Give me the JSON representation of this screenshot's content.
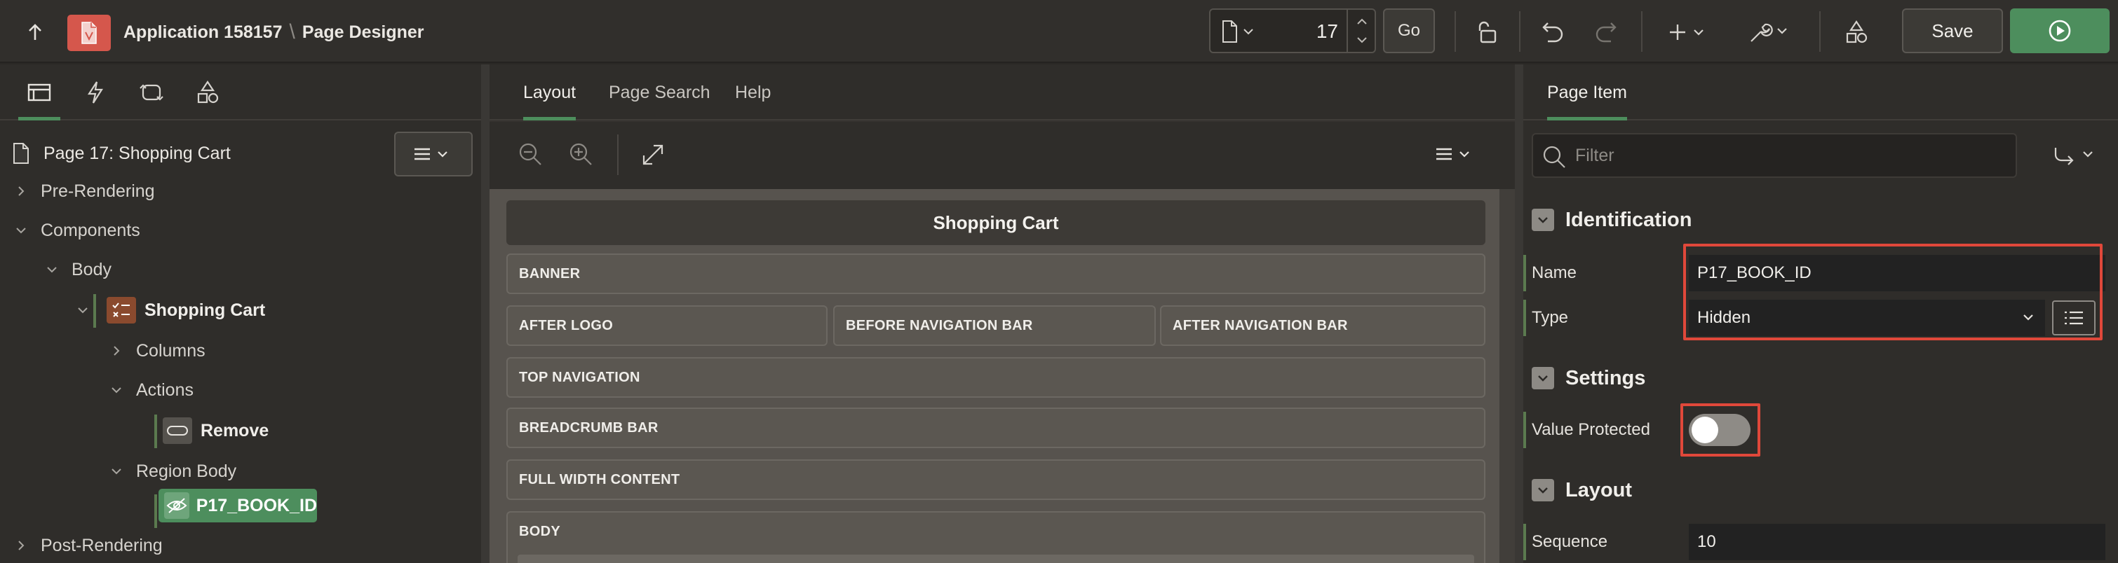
{
  "toolbar": {
    "app_name": "Application 158157",
    "separator": "\\",
    "page_name": "Page Designer",
    "page_number": "17",
    "go_label": "Go",
    "save_label": "Save",
    "accent_run": "#4d8e5d",
    "accent_app": "#d5574c"
  },
  "left": {
    "tabs": [
      "rendering-tab",
      "dynamic-actions-tab",
      "processing-tab",
      "shared-components-tab"
    ],
    "root": "Page 17: Shopping Cart",
    "tree": [
      {
        "label": "Pre-Rendering",
        "expanded": false
      },
      {
        "label": "Components",
        "expanded": true
      },
      {
        "label": "Body",
        "expanded": true
      },
      {
        "label": "Shopping Cart",
        "expanded": true
      },
      {
        "label": "Columns",
        "expanded": false
      },
      {
        "label": "Actions",
        "expanded": true
      },
      {
        "label": "Remove"
      },
      {
        "label": "Region Body",
        "expanded": true
      },
      {
        "label": "P17_BOOK_ID",
        "selected": true
      },
      {
        "label": "Post-Rendering",
        "expanded": false
      }
    ]
  },
  "center": {
    "tabs": [
      "Layout",
      "Page Search",
      "Help"
    ],
    "active_tab": "Layout",
    "region_title": "Shopping Cart",
    "slots": {
      "banner": "BANNER",
      "after_logo": "AFTER LOGO",
      "before_nav": "BEFORE NAVIGATION BAR",
      "after_nav": "AFTER NAVIGATION BAR",
      "top_nav": "TOP NAVIGATION",
      "breadcrumb_bar": "BREADCRUMB BAR",
      "full_width": "FULL WIDTH CONTENT",
      "body": "BODY"
    }
  },
  "right": {
    "tab": "Page Item",
    "filter_placeholder": "Filter",
    "groups": {
      "identification": "Identification",
      "settings": "Settings",
      "layout": "Layout"
    },
    "props": {
      "name_label": "Name",
      "name_value": "P17_BOOK_ID",
      "type_label": "Type",
      "type_value": "Hidden",
      "value_protected_label": "Value Protected",
      "value_protected": false,
      "sequence_label": "Sequence",
      "sequence_value": "10"
    },
    "highlight_color": "#e0483a"
  }
}
